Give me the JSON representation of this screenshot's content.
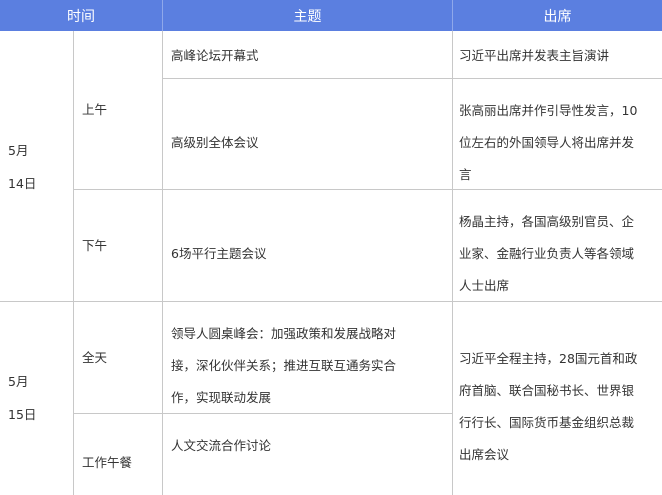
{
  "header": {
    "time": "时间",
    "topic": "主题",
    "attend": "出席"
  },
  "day1": {
    "date": [
      "5月",
      "14日"
    ],
    "am_label": "上午",
    "pm_label": "下午",
    "topic1": "高峰论坛开幕式",
    "attend1": "习近平出席并发表主旨演讲",
    "topic2": "高级别全体会议",
    "attend2": [
      "张高丽出席并作引导性发言，10",
      "位左右的外国领导人将出席并发",
      "言"
    ],
    "topic3": "6场平行主题会议",
    "attend3": [
      "杨晶主持，各国高级别官员、企",
      "业家、金融行业负责人等各领域",
      "人士出席"
    ]
  },
  "day2": {
    "date": [
      "5月",
      "15日"
    ],
    "allday_label": "全天",
    "lunch_label": "工作午餐",
    "topic1": [
      "领导人圆桌峰会：加强政策和发展战略对",
      "接，深化伙伴关系；推进互联互通务实合",
      "作，实现联动发展"
    ],
    "topic2": "人文交流合作讨论",
    "attend": [
      "习近平全程主持，28国元首和政",
      "府首脑、联合国秘书长、世界银",
      "行行长、国际货币基金组织总裁",
      "出席会议"
    ]
  }
}
